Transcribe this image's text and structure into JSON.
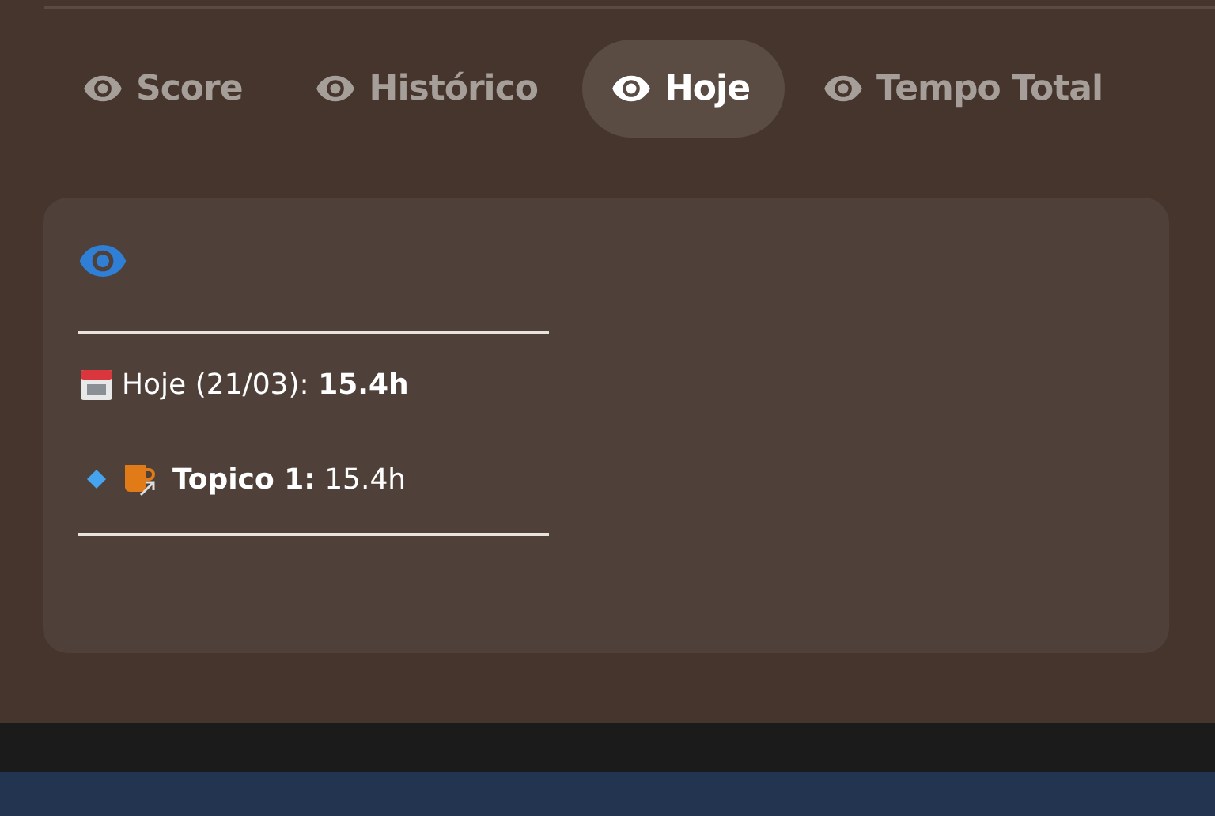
{
  "tabs": [
    {
      "label": "Score",
      "selected": false
    },
    {
      "label": "Histórico",
      "selected": false
    },
    {
      "label": "Hoje",
      "selected": true
    },
    {
      "label": "Tempo Total",
      "selected": false
    }
  ],
  "card": {
    "summary": "Hoje (21/03): **15.4h**",
    "items": [
      {
        "text": "**Topico 1:** 15.4h"
      }
    ]
  }
}
